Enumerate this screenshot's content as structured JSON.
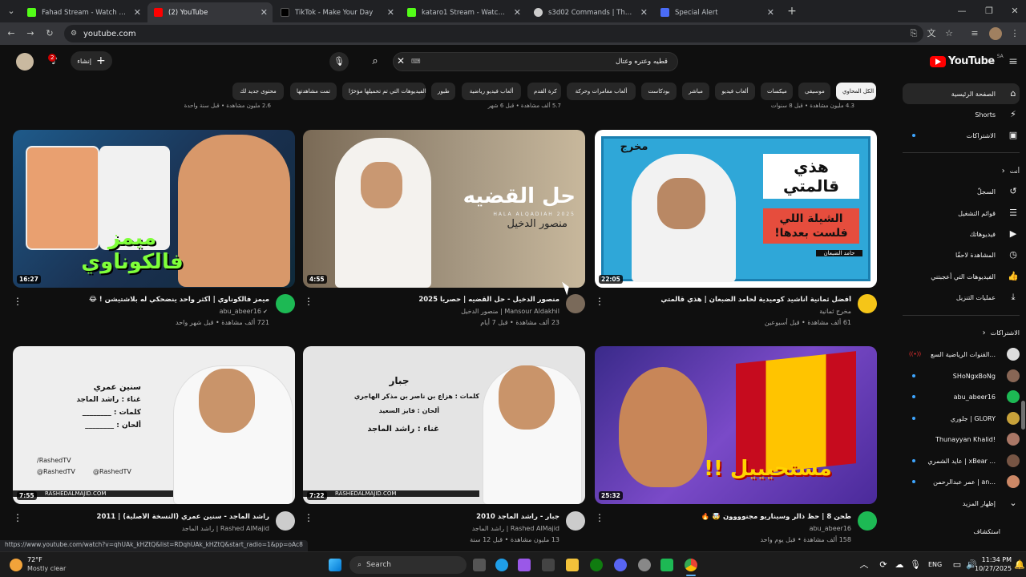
{
  "browser": {
    "tabs": [
      {
        "title": "Fahad Stream - Watch Live on K",
        "favicon_color": "#53fc18"
      },
      {
        "title": "(2) YouTube",
        "favicon_color": "#ff0000"
      },
      {
        "title": "TikTok - Make Your Day",
        "favicon_color": "#000000"
      },
      {
        "title": "kataro1 Stream - Watch Live on",
        "favicon_color": "#53fc18"
      },
      {
        "title": "s3d02 Commands | The best Ch",
        "favicon_color": "#cccccc"
      },
      {
        "title": "Special Alert",
        "favicon_color": "#4a6cf7"
      }
    ],
    "url": "youtube.com",
    "status_url": "https://www.youtube.com/watch?v=qhUAk_kHZtQ&list=RDqhUAk_kHZtQ&start_radio=1&pp=oAc8"
  },
  "youtube": {
    "create_label": "إنشاء",
    "notification_count": "2",
    "search_query": "قطيه وعتره وعتال",
    "logo_text": "YouTube",
    "region": "SA",
    "chips": [
      "الكل المحاوي",
      "موسيقى",
      "ميكسات",
      "ألعاب فيديو",
      "مباشر",
      "بودكاست",
      "ألعاب مغامرات وحركة",
      "كرة القدم",
      "ألعاب فيديو رياضية",
      "طبور",
      "الفيديوهات التي تم تحميلها مؤخرًا",
      "تمت مشاهدتها",
      "محتوى جديد لك"
    ],
    "videos": [
      {
        "title": "ميمز فالكوناوي | أكثر واحد ينضحكي له بلاشتيشن ! 😂",
        "channel": "abu_abeer16",
        "meta": "721 ألف مشاهدة • قبل شهر واحد",
        "duration": "16:27",
        "thumb": "#2a4a6a",
        "avatar": "#1db954",
        "verified": true
      },
      {
        "title": "منصور الدخيل - حل القضيه | حصريا 2025",
        "channel": "Mansour Aldakhil | منصور الدخيل",
        "meta": "23 ألف مشاهدة • قبل 7 أيام",
        "duration": "4:55",
        "thumb": "#6b5a48",
        "avatar": "#7a6a5a",
        "verified": false
      },
      {
        "title": "أفضل ثمانية أناشيد كوميدية لحامد الضبعان | هذي قالمتي",
        "channel": "مخرج ثمانية",
        "meta": "61 ألف مشاهدة • قبل أسبوعين",
        "duration": "22:05",
        "thumb": "#2fa7d8",
        "avatar": "#f5c518",
        "verified": false
      },
      {
        "title": "راشد الماجد - سنين عمري (النسخة الأصلية) | 2011",
        "channel": "Rashed AlMajid | راشد الماجد",
        "meta": "",
        "duration": "7:55",
        "thumb": "#e8e8e8",
        "avatar": "#cccccc",
        "verified": false
      },
      {
        "title": "جبار - راشد الماجد 2010",
        "channel": "Rashed AlMajid | راشد الماجد",
        "meta": "13 مليون مشاهدة • قبل 12 سنة",
        "duration": "7:22",
        "thumb": "#d8d8d8",
        "avatar": "#cccccc",
        "verified": false
      },
      {
        "title": "طحن 8 | حظ ذالر وسيناريو مجنوووون 🤯 🔥",
        "channel": "abu_abeer16",
        "meta": "158 ألف مشاهدة • قبل يوم واحد",
        "duration": "25:32",
        "thumb": "#5b3aa8",
        "avatar": "#1db954",
        "verified": false
      }
    ],
    "thumb_texts": {
      "v1": "ميمز فالكوناوي",
      "v2_a": "حل القضيه",
      "v2_b": "منصور الدخيل",
      "v2_c": "HALA ALQADIAH 2025",
      "v3_a": "مخرج",
      "v3_b": "هذي قالمتي",
      "v3_c": "الشيلة اللي فلست بعدها!",
      "v3_d": "حامد الضبعان",
      "v4_a": "سنين عمري",
      "v4_b": "غناء : راشد الماجد",
      "v4_c": "كلمات : ________",
      "v4_d": "ألحان : ________",
      "v4_e": "/RashedTV",
      "v4_f": "@RashedTV",
      "v4_g": "@RashedTV",
      "v4_h": "RASHEDALMAJID.COM",
      "v5_a": "جبار",
      "v5_b": "كلمات : هزاع بن ناصر بن مذكر الهاجري",
      "v5_c": "ألحان : فايز السعيد",
      "v5_d": "غناء : راشد الماجد",
      "v5_e": "RASHEDALMAJID.COM",
      "v6": "مستحيييل !!"
    },
    "top_partial_meta": [
      "2.6 مليون مشاهدة • قبل سنة واحدة",
      "5.7 ألف مشاهدة • قبل 6 شهر",
      "4.3 مليون مشاهدة • قبل 8 سنوات"
    ],
    "sidebar": {
      "main": [
        {
          "label": "الصفحة الرئيسية",
          "icon": "home-icon"
        },
        {
          "label": "Shorts",
          "icon": "shorts-icon"
        },
        {
          "label": "الاشتراكات",
          "icon": "subscriptions-icon"
        }
      ],
      "you_heading": "أنت",
      "you": [
        {
          "label": "السجلّ",
          "icon": "history-icon"
        },
        {
          "label": "قوائم التشغيل",
          "icon": "playlist-icon"
        },
        {
          "label": "فيديوهاتك",
          "icon": "your-videos-icon"
        },
        {
          "label": "المشاهدة لاحقًا",
          "icon": "watch-later-icon"
        },
        {
          "label": "الفيديوهات التي أعجبتني",
          "icon": "like-icon"
        },
        {
          "label": "عمليات التنزيل",
          "icon": "download-icon"
        }
      ],
      "subs_heading": "الاشتراكات",
      "subs": [
        {
          "label": "القنوات الرياضية السع...",
          "color": "#dddddd"
        },
        {
          "label": "SHoNgxBoNg",
          "color": "#886655"
        },
        {
          "label": "abu_abeer16",
          "color": "#1db954"
        },
        {
          "label": "جلوري | GLORY",
          "color": "#c8a23a"
        },
        {
          "label": "Thunayyan Khalid!",
          "color": "#aa7766"
        },
        {
          "label": "عايد الشمري | xBear ...",
          "color": "#775544"
        },
        {
          "label": "عمر عبدالرحمن | an...",
          "color": "#cc8866"
        }
      ],
      "show_more": "إظهار المزيد",
      "explore": "استكشاف"
    }
  },
  "taskbar": {
    "temp": "72°F",
    "weather": "Mostly clear",
    "search_label": "Search",
    "lang": "ENG",
    "time": "11:34 PM",
    "date": "10/27/2025"
  }
}
